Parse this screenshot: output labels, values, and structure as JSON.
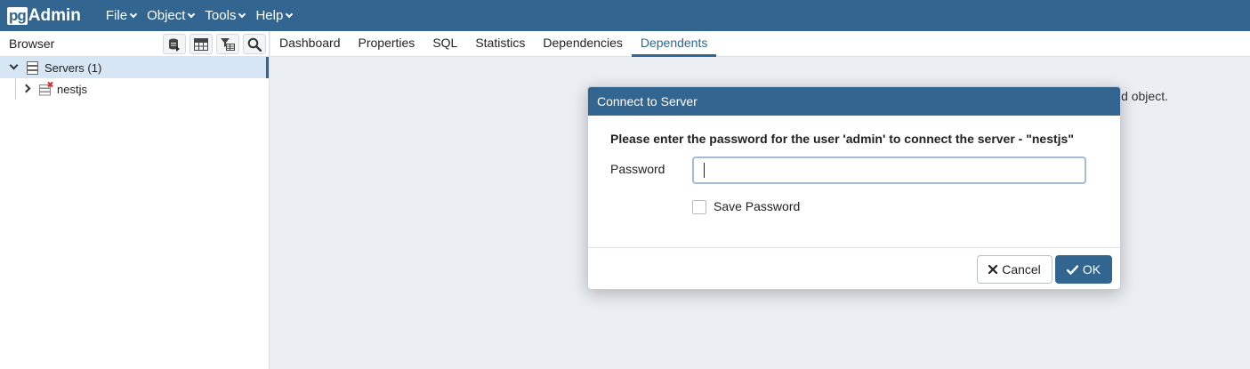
{
  "app": {
    "logo_pg": "pg",
    "logo_admin": "Admin"
  },
  "menu": [
    {
      "label": "File"
    },
    {
      "label": "Object"
    },
    {
      "label": "Tools"
    },
    {
      "label": "Help"
    }
  ],
  "browser": {
    "title": "Browser",
    "toolbar_icons": [
      "query-tool-icon",
      "view-data-icon",
      "filtered-rows-icon",
      "search-objects-icon"
    ],
    "tree": [
      {
        "label": "Servers (1)",
        "selected": true
      },
      {
        "label": "nestjs",
        "selected": false
      }
    ]
  },
  "tabs": [
    {
      "label": "Dashboard"
    },
    {
      "label": "Properties"
    },
    {
      "label": "SQL"
    },
    {
      "label": "Statistics"
    },
    {
      "label": "Dependencies"
    },
    {
      "label": "Dependents",
      "active": true
    }
  ],
  "content": {
    "hint_text": "d object."
  },
  "dialog": {
    "title": "Connect to Server",
    "message": "Please enter the password for the user 'admin' to connect the server - \"nestjs\"",
    "password_label": "Password",
    "password_value": "",
    "save_password_label": "Save Password",
    "save_password_checked": false,
    "cancel_label": "Cancel",
    "ok_label": "OK"
  },
  "colors": {
    "brand": "#326690",
    "background": "#ebeef3",
    "error_badge": "#d9262c"
  }
}
